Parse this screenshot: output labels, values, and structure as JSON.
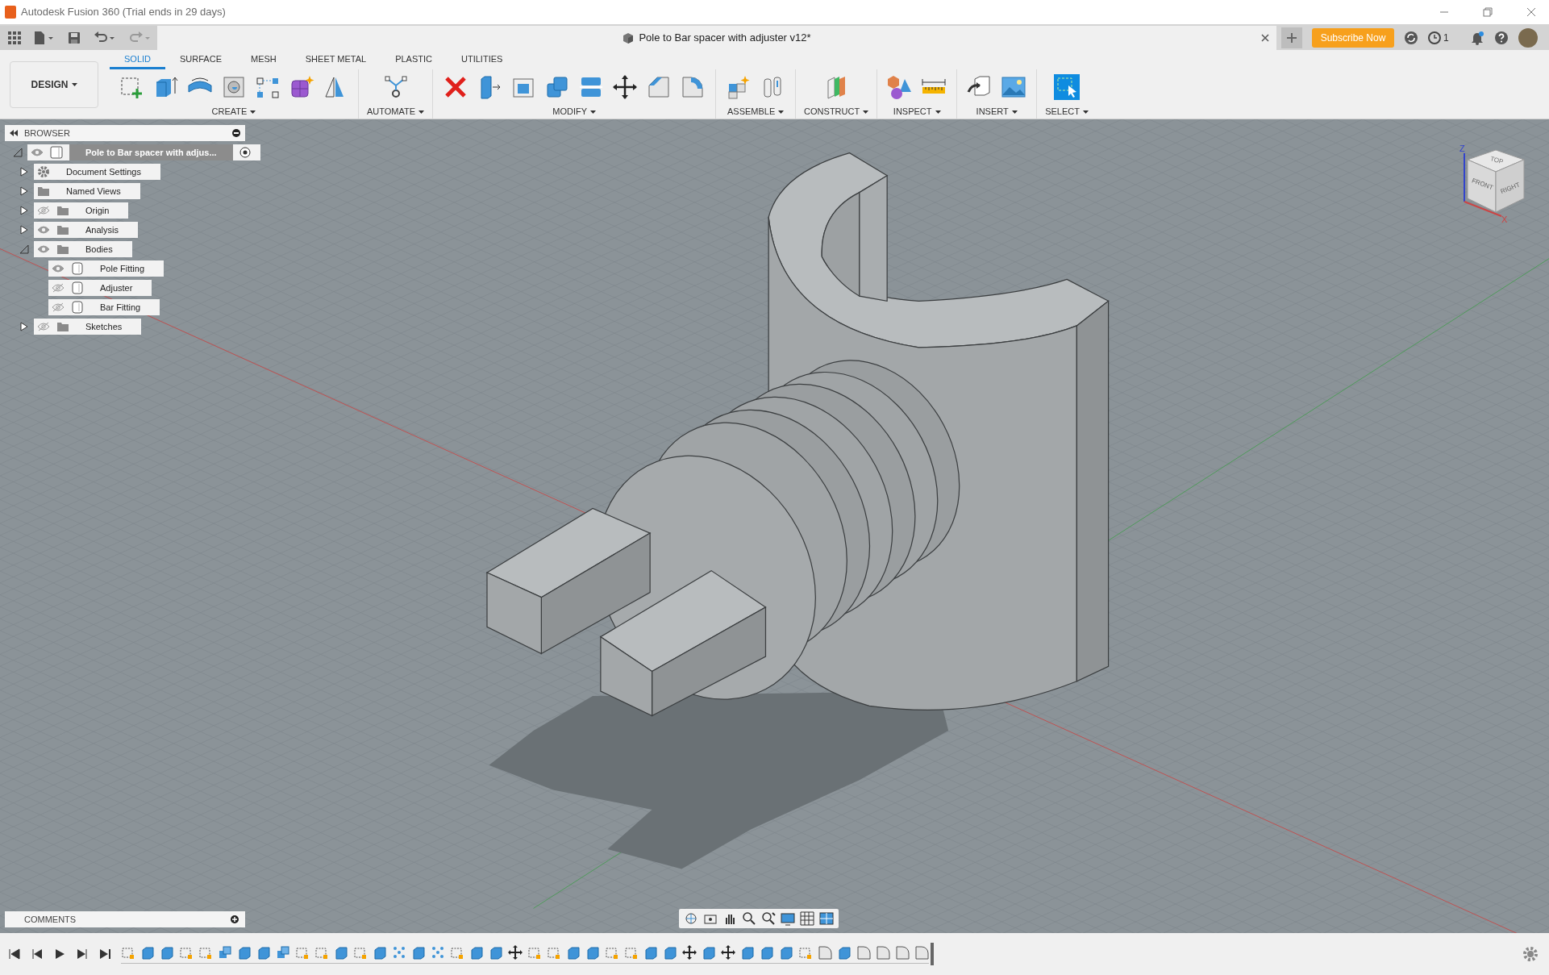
{
  "app_title": "Autodesk Fusion 360 (Trial ends in 29 days)",
  "document_tab": {
    "title": "Pole to Bar spacer with adjuster v12*"
  },
  "subscribe_button": "Subscribe Now",
  "job_status": {
    "count": "1"
  },
  "notifications": {
    "unread": true
  },
  "workspace": "DESIGN",
  "toolbar_tabs": [
    {
      "label": "SOLID",
      "selected": true
    },
    {
      "label": "SURFACE",
      "selected": false
    },
    {
      "label": "MESH",
      "selected": false
    },
    {
      "label": "SHEET METAL",
      "selected": false
    },
    {
      "label": "PLASTIC",
      "selected": false
    },
    {
      "label": "UTILITIES",
      "selected": false
    }
  ],
  "toolbar_groups": [
    {
      "label": "CREATE",
      "tools": [
        {
          "kind": "sketch"
        },
        {
          "kind": "extrude"
        },
        {
          "kind": "revolve"
        },
        {
          "kind": "hole"
        },
        {
          "kind": "pattern"
        },
        {
          "kind": "form"
        },
        {
          "kind": "mirror"
        }
      ]
    },
    {
      "label": "AUTOMATE",
      "tools": [
        {
          "kind": "automate"
        }
      ]
    },
    {
      "label": "MODIFY",
      "tools": [
        {
          "kind": "delete"
        },
        {
          "kind": "presspull"
        },
        {
          "kind": "shell"
        },
        {
          "kind": "combine"
        },
        {
          "kind": "offset"
        },
        {
          "kind": "move"
        },
        {
          "kind": "chamfer"
        },
        {
          "kind": "fillet"
        }
      ]
    },
    {
      "label": "ASSEMBLE",
      "tools": [
        {
          "kind": "component"
        },
        {
          "kind": "joint"
        }
      ]
    },
    {
      "label": "CONSTRUCT",
      "tools": [
        {
          "kind": "plane"
        }
      ]
    },
    {
      "label": "INSPECT",
      "tools": [
        {
          "kind": "shapes"
        },
        {
          "kind": "ruler"
        }
      ]
    },
    {
      "label": "INSERT",
      "tools": [
        {
          "kind": "derive"
        },
        {
          "kind": "image"
        }
      ]
    },
    {
      "label": "SELECT",
      "tools": [
        {
          "kind": "select"
        }
      ]
    }
  ],
  "browser": {
    "title": "BROWSER",
    "root": {
      "label": "Pole to Bar spacer with adjus...",
      "kind": "component",
      "visible": true,
      "expanded": true,
      "children": [
        {
          "label": "Document Settings",
          "kind": "gear",
          "expanded": false
        },
        {
          "label": "Named Views",
          "kind": "folder",
          "expanded": false
        },
        {
          "label": "Origin",
          "kind": "folder",
          "visible": false,
          "expanded": false
        },
        {
          "label": "Analysis",
          "kind": "folder",
          "visible": true,
          "expanded": false
        },
        {
          "label": "Bodies",
          "kind": "folder",
          "visible": true,
          "expanded": true,
          "children": [
            {
              "label": "Pole Fitting",
              "kind": "body",
              "visible": true
            },
            {
              "label": "Adjuster",
              "kind": "body",
              "visible": false
            },
            {
              "label": "Bar Fitting",
              "kind": "body",
              "visible": false
            }
          ]
        },
        {
          "label": "Sketches",
          "kind": "folder",
          "visible": false,
          "expanded": false
        }
      ]
    }
  },
  "comments": {
    "title": "COMMENTS"
  },
  "viewcube": {
    "top": "TOP",
    "front": "FRONT",
    "right": "RIGHT",
    "z_axis": "Z",
    "x_axis": "X"
  }
}
